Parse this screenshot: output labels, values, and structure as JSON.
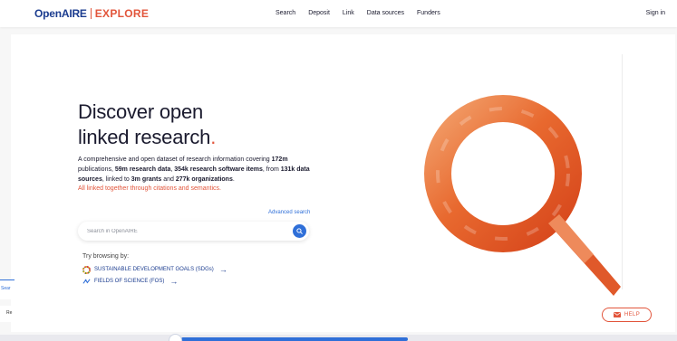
{
  "header": {
    "logo_primary": "OpenAIRE",
    "logo_secondary": "EXPLORE",
    "nav": [
      "Search",
      "Deposit",
      "Link",
      "Data sources",
      "Funders"
    ],
    "signin": "Sign in"
  },
  "hero": {
    "title_line1": "Discover open",
    "title_line2": "linked research",
    "title_dot": ".",
    "desc_1": "A comprehensive and open dataset of research information covering ",
    "desc_2": "172m",
    "desc_3": " publications, ",
    "desc_4": "59m research data",
    "desc_5": ", ",
    "desc_6": "354k research software items",
    "desc_7": ", from ",
    "desc_8": "131k data sources",
    "desc_9": ", linked to ",
    "desc_10": "3m grants",
    "desc_11": " and ",
    "desc_12": "277k organizations",
    "desc_13": ".",
    "accent_line": "All linked together through citations and semantics."
  },
  "search": {
    "advanced": "Advanced search",
    "placeholder": "Search in OpenAIRE"
  },
  "browse": {
    "label": "Try browsing by:",
    "items": [
      {
        "label": "SUSTAINABLE DEVELOPMENT GOALS (SDGs)",
        "icon": "sdg-wheel-icon"
      },
      {
        "label": "FIELDS OF SCIENCE (FOS)",
        "icon": "fos-icon"
      }
    ],
    "arrow": "→"
  },
  "help": {
    "label": "HELP"
  },
  "side_fragments": {
    "top": "Sear",
    "bottom": "Re"
  },
  "colors": {
    "brand_blue": "#1b3c8f",
    "accent_orange": "#e2553b",
    "action_blue": "#2f6fd8"
  }
}
